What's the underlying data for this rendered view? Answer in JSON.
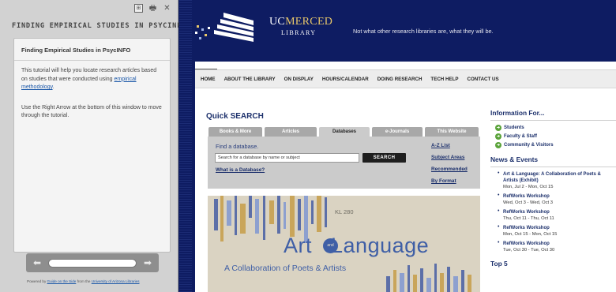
{
  "guide": {
    "toolbar": {
      "icon1": "⊞",
      "icon2": "🖶",
      "close": "✕"
    },
    "title": "FINDING EMPIRICAL STUDIES IN PSYCINFO",
    "heading": "Finding Empirical Studies in PsycINFO",
    "p1_text": "This tutorial will help you locate research articles based on studies that were conducted using",
    "p1_link": "empirical methodology",
    "p1_end": ".",
    "p2": "Use the Right Arrow at the bottom of this window to move through the tutorial.",
    "nav": {
      "prev": "⬅",
      "next": "➡"
    },
    "footer": {
      "prefix": "Powered by",
      "link1": "Guide on the Side",
      "mid": "from the",
      "link2": "University of Arizona Libraries"
    }
  },
  "site": {
    "logo": {
      "uc": "UC",
      "merced": "MERCED",
      "library": "LIBRARY"
    },
    "tagline": "Not what other research libraries are, what they will be.",
    "nav": [
      "HOME",
      "ABOUT THE LIBRARY",
      "ON DISPLAY",
      "HOURS/CALENDAR",
      "DOING RESEARCH",
      "TECH HELP",
      "CONTACT US"
    ],
    "quick_search": {
      "title": "Quick SEARCH",
      "tabs": [
        "Books & More",
        "Articles",
        "Databases",
        "e-Journals",
        "This Website"
      ],
      "active_tab": "Databases",
      "find_label": "Find a database.",
      "search_value": "Search for a database by name or subject",
      "search_button": "SEARCH",
      "what_link": "What is a Database?",
      "links": [
        "A-Z List",
        "Subject Areas",
        "Recommended",
        "By Format"
      ]
    },
    "banner": {
      "kl": "KL 280",
      "art": "Art",
      "and": "and",
      "language": "Language",
      "subtitle": "A Collaboration of Poets & Artists"
    },
    "sidebar": {
      "info_title": "Information For...",
      "info_links": [
        "Students",
        "Faculty & Staff",
        "Community & Visitors"
      ],
      "news_title": "News & Events",
      "events": [
        {
          "title": "Art & Language: A Collaboration of Poets & Artists (Exhibit)",
          "date": "Mon, Jul 2 - Mon, Oct 15"
        },
        {
          "title": "RefWorks Workshop",
          "date": "Wed, Oct 3 - Wed, Oct 3"
        },
        {
          "title": "RefWorks Workshop",
          "date": "Thu, Oct 11 - Thu, Oct 11"
        },
        {
          "title": "RefWorks Workshop",
          "date": "Mon, Oct 15 - Mon, Oct 15"
        },
        {
          "title": "RefWorks Workshop",
          "date": "Tue, Oct 30 - Tue, Oct 30"
        }
      ],
      "top_title": "Top 5"
    }
  }
}
